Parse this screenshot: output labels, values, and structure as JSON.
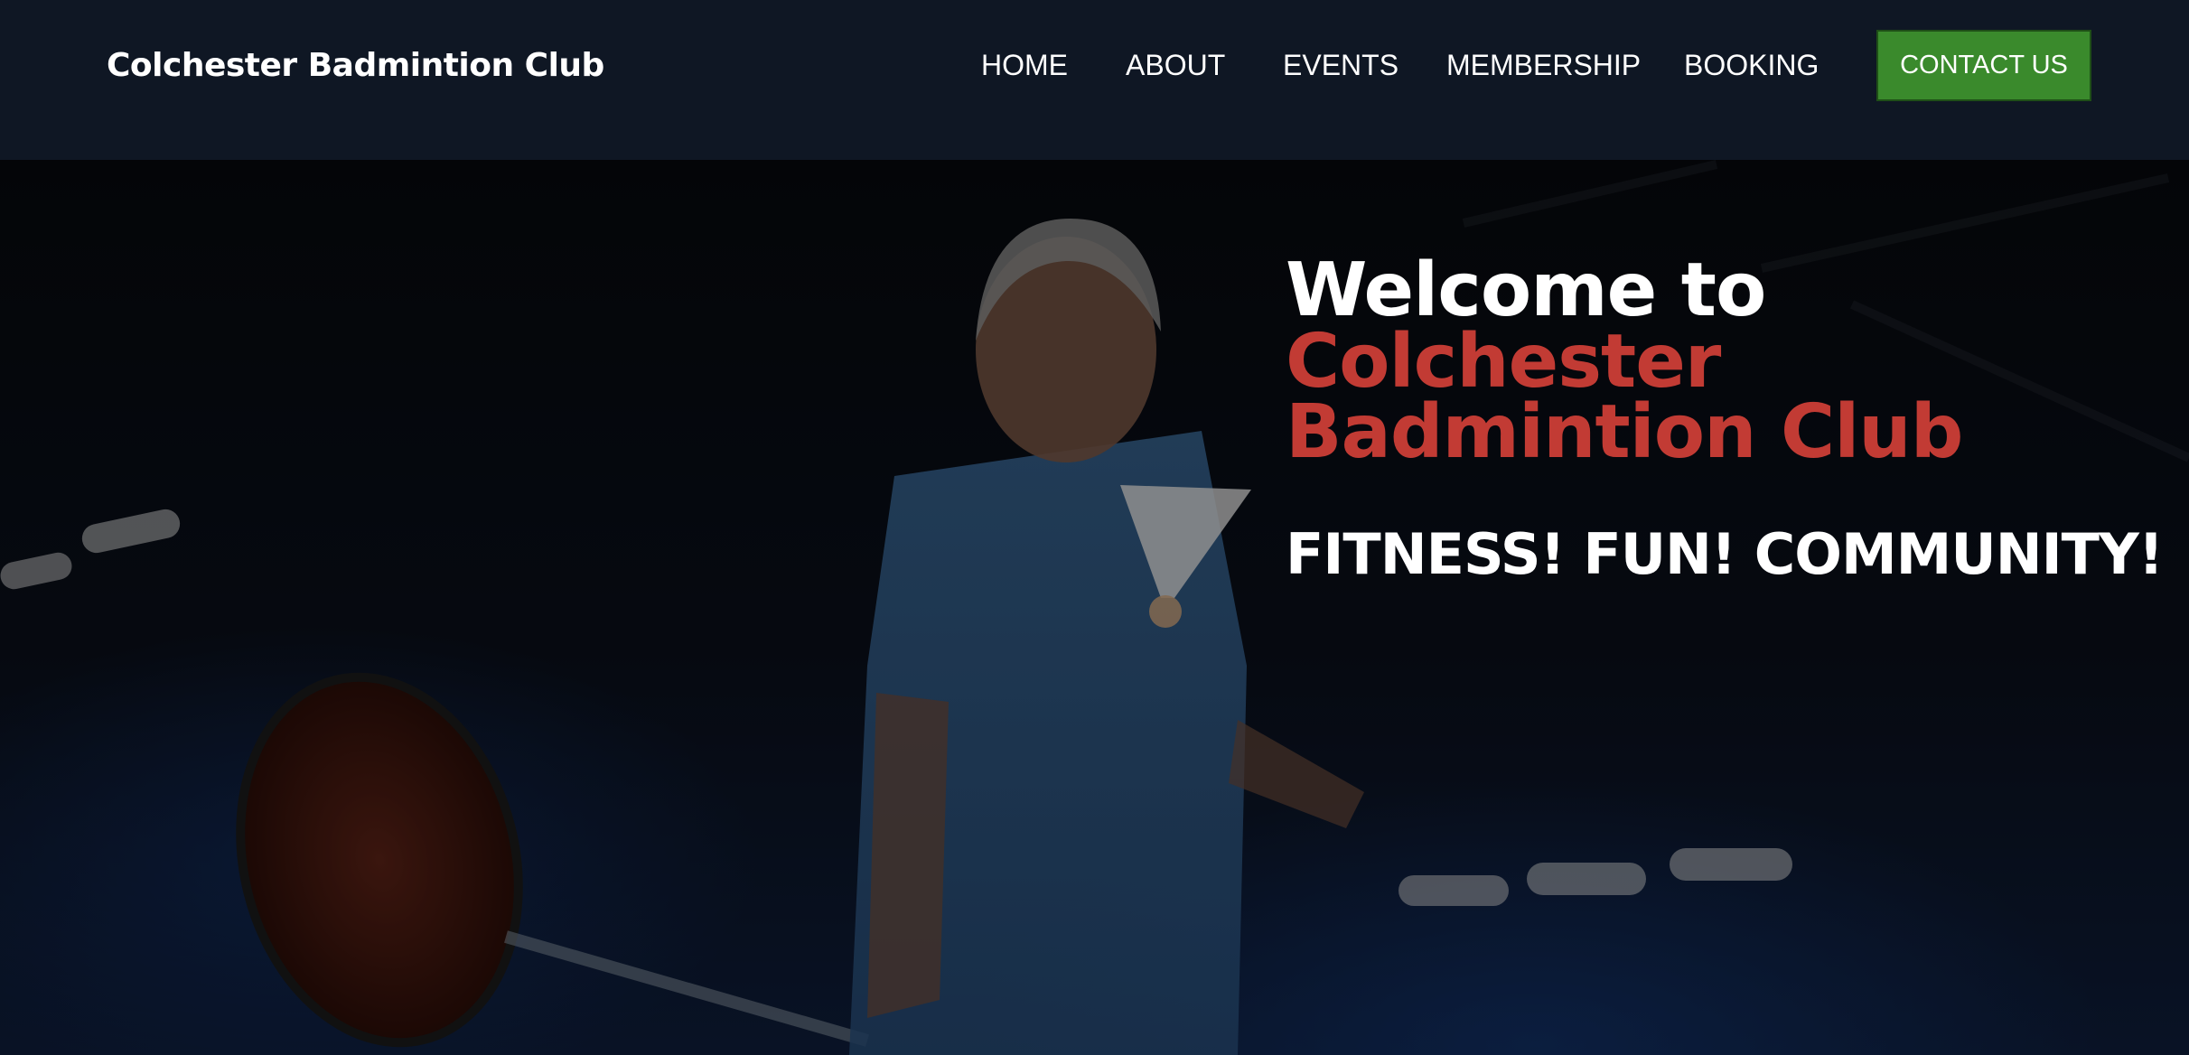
{
  "header": {
    "brand": "Colchester Badmintion Club",
    "nav": [
      {
        "label": "HOME"
      },
      {
        "label": "ABOUT"
      },
      {
        "label": "EVENTS"
      },
      {
        "label": "MEMBERSHIP"
      },
      {
        "label": "BOOKING"
      }
    ],
    "contact_label": "CONTACT US"
  },
  "hero": {
    "welcome": "Welcome to",
    "club_line1": "Colchester",
    "club_line2": "Badmintion Club",
    "tagline": "FITNESS! FUN! COMMUNITY!",
    "photo_icon": "badminton-player-photo"
  },
  "colors": {
    "header_bg": "#0f1724",
    "accent_red": "#c23b34",
    "contact_green": "#3a8a2c",
    "text": "#ffffff"
  }
}
